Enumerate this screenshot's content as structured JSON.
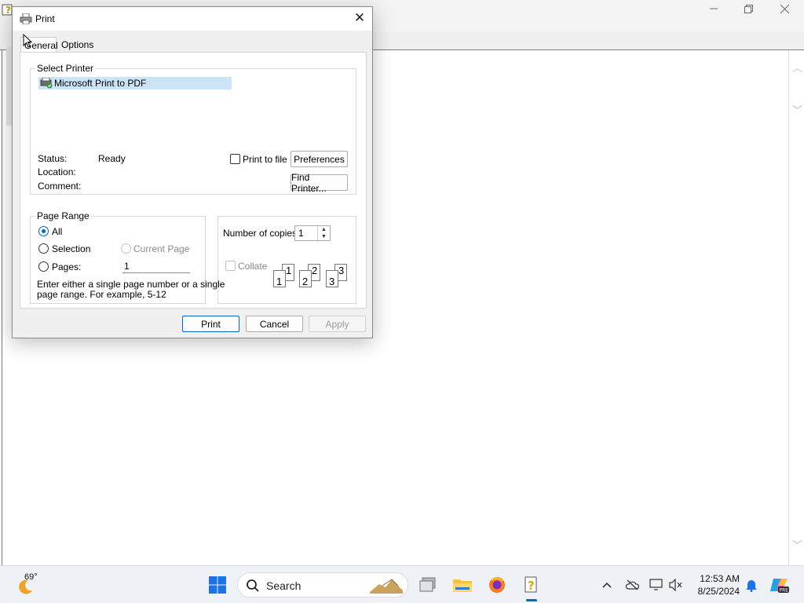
{
  "dialog": {
    "title": "Print",
    "close_label": "✕",
    "tabs": [
      {
        "label": "General"
      },
      {
        "label": "Options"
      }
    ],
    "select_printer": {
      "group_label": "Select Printer",
      "printers": [
        {
          "name": "Microsoft Print to PDF",
          "selected": true
        }
      ],
      "status_label": "Status:",
      "status_value": "Ready",
      "location_label": "Location:",
      "comment_label": "Comment:",
      "print_to_file_label": "Print to file",
      "print_to_file_checked": false,
      "preferences_button": "Preferences",
      "find_printer_button": "Find Printer..."
    },
    "page_range": {
      "group_label": "Page Range",
      "all_label": "All",
      "selection_label": "Selection",
      "current_page_label": "Current Page",
      "pages_label": "Pages:",
      "pages_value": "1",
      "selected": "All",
      "hint_line1": "Enter either a single page number or a single",
      "hint_line2": "page range.  For example, 5-12"
    },
    "copies": {
      "label": "Number of copies:",
      "value": "1",
      "collate_label": "Collate",
      "collate_checked": false,
      "collate_pages": [
        "1",
        "1",
        "2",
        "2",
        "3",
        "3"
      ]
    },
    "buttons": {
      "print": "Print",
      "cancel": "Cancel",
      "apply": "Apply"
    }
  },
  "background_window": {
    "minimize_icon": "minimize-icon",
    "restore_icon": "restore-icon",
    "close_icon": "close-icon"
  },
  "taskbar": {
    "weather_temp": "69°",
    "search_label": "Search",
    "time": "12:53 AM",
    "date": "8/25/2024",
    "accent_color": "#0067c0"
  }
}
